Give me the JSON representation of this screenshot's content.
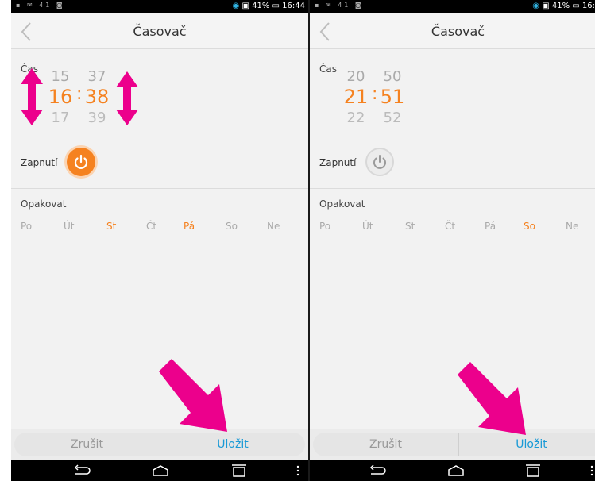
{
  "colors": {
    "accent": "#f58220",
    "link": "#1a9ad6",
    "pink_annotation": "#ec008c"
  },
  "left": {
    "status": {
      "icons_left": "▪ ✉ 41 ◙",
      "battery": "41%",
      "time": "16:44"
    },
    "title": "Časovač",
    "time_label": "Čas",
    "hours": {
      "prev": "15",
      "selected": "16",
      "next": "17"
    },
    "minutes": {
      "prev": "37",
      "selected": "38",
      "next": "39"
    },
    "colon": ":",
    "power_label": "Zapnutí",
    "power_on": true,
    "repeat_label": "Opakovat",
    "days": [
      "Po",
      "Út",
      "St",
      "Čt",
      "Pá",
      "So",
      "Ne"
    ],
    "days_active": [
      false,
      false,
      true,
      false,
      true,
      false,
      false
    ],
    "cancel": "Zrušit",
    "save": "Uložit"
  },
  "right": {
    "status": {
      "icons_left": "▪ ✉ 41 ◙",
      "battery": "41%",
      "time": "16:"
    },
    "title": "Časovač",
    "time_label": "Čas",
    "hours": {
      "prev": "20",
      "selected": "21",
      "next": "22"
    },
    "minutes": {
      "prev": "50",
      "selected": "51",
      "next": "52"
    },
    "colon": ":",
    "power_label": "Zapnutí",
    "power_on": false,
    "repeat_label": "Opakovat",
    "days": [
      "Po",
      "Út",
      "St",
      "Čt",
      "Pá",
      "So",
      "Ne"
    ],
    "days_active": [
      false,
      false,
      false,
      false,
      false,
      true,
      false
    ],
    "cancel": "Zrušit",
    "save": "Uložit"
  }
}
